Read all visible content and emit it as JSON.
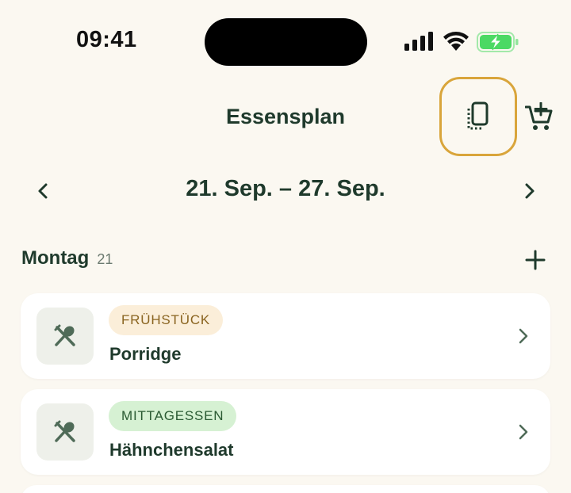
{
  "status_bar": {
    "time": "09:41"
  },
  "header": {
    "title": "Essensplan",
    "copy_icon": "copy-icon",
    "cart_icon": "cart-add-icon"
  },
  "week": {
    "range": "21. Sep. – 27. Sep."
  },
  "day": {
    "name": "Montag",
    "number": "21"
  },
  "meals": [
    {
      "tag": "FRÜHSTÜCK",
      "name": "Porridge",
      "icon": "utensils-icon"
    },
    {
      "tag": "MITTAGESSEN",
      "name": "Hähnchensalat",
      "icon": "utensils-icon"
    }
  ],
  "colors": {
    "background": "#fbf8f1",
    "primary_text": "#1f3a2c",
    "highlight_ring": "#d9a53b",
    "breakfast_tag_bg": "#fbeed9",
    "lunch_tag_bg": "#d6f1d3",
    "battery_green": "#4cd964"
  }
}
